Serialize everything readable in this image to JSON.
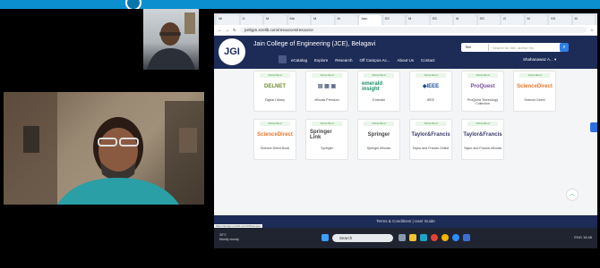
{
  "meeting": {
    "topbar_color": "#0c8fce"
  },
  "browser": {
    "tabs": [
      "Mi",
      "G",
      "M",
      "Me",
      "M",
      "M",
      "Jain",
      "SS",
      "M",
      "SS",
      "M",
      "SS",
      "G",
      "M",
      "SS",
      "M"
    ],
    "url": "jcebgm.ezelib.com/resources/resource"
  },
  "site": {
    "logo_text": "JGI",
    "institution": "Jain College of Engineering (JCE), Belagavi",
    "search_scope": "Title",
    "search_placeholder": "Search for title, author etc",
    "nav": [
      "eCatalog",
      "Explore",
      "Research",
      "Off Campus Ac...",
      "About Us",
      "Contact"
    ],
    "user": "Shahanawaz A... ▾",
    "footer": "Terms & Conditions | User Guide",
    "status_url": "https://jcebgm.ezelib.com/OffCampus"
  },
  "resources": [
    {
      "badge": "Subscribed",
      "logo": "DELNET",
      "caption": "Digital Library",
      "color": "#6a8f2e"
    },
    {
      "badge": "Subscribed",
      "logo": "▤ ▦ ▣",
      "caption": "eBooks Premium",
      "color": "#5b6b8c"
    },
    {
      "badge": "Subscribed",
      "logo": "emerald insight",
      "caption": "Emerald",
      "color": "#1f8f6a"
    },
    {
      "badge": "Subscribed",
      "logo": "◆IEEE",
      "caption": "IEEE",
      "color": "#1b4c9a"
    },
    {
      "badge": "Subscribed",
      "logo": "ProQuest",
      "caption": "ProQuest Technology Collection",
      "color": "#7a4aa0"
    },
    {
      "badge": "Subscribed",
      "logo": "ScienceDirect",
      "caption": "Science Direct",
      "color": "#e8742a"
    },
    {
      "badge": "Subscribed",
      "logo": "ScienceDirect",
      "caption": "Science Direct Book",
      "color": "#e8742a"
    },
    {
      "badge": "Subscribed",
      "logo": "Springer Link",
      "caption": "Springer",
      "color": "#444"
    },
    {
      "badge": "Subscribed",
      "logo": "Springer",
      "caption": "Springer eBooks",
      "color": "#444"
    },
    {
      "badge": "Subscribed",
      "logo": "Taylor&Francis",
      "caption": "Taylor and Francis Online",
      "color": "#3a3a6a"
    },
    {
      "badge": "Subscribed",
      "logo": "Taylor&Francis",
      "caption": "Taylor and Francis eBooks",
      "color": "#3a3a6a"
    }
  ],
  "taskbar": {
    "weather": "30°C\nMostly cloudy",
    "search": "Search",
    "tray": "ENG  16:48"
  }
}
